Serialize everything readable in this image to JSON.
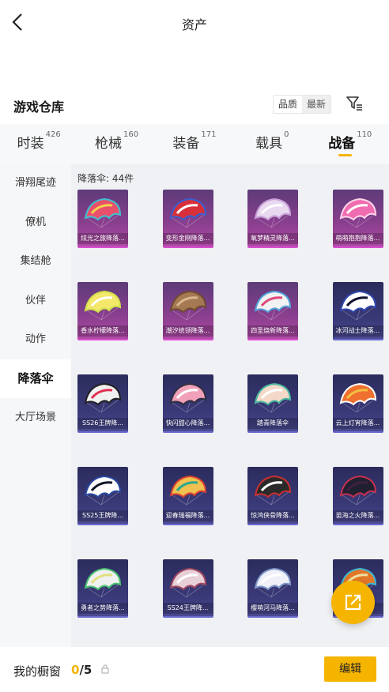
{
  "header": {
    "title": "资产"
  },
  "section": {
    "title": "游戏仓库"
  },
  "sort": {
    "options": [
      "品质",
      "最新"
    ]
  },
  "tabs": [
    {
      "label": "时装",
      "count": "426"
    },
    {
      "label": "枪械",
      "count": "160"
    },
    {
      "label": "装备",
      "count": "171"
    },
    {
      "label": "载具",
      "count": "0"
    },
    {
      "label": "战备",
      "count": "110"
    }
  ],
  "sidebar": {
    "items": [
      "滑翔尾迹",
      "僚机",
      "集结舱",
      "伙伴",
      "动作",
      "降落伞",
      "大厅场景"
    ]
  },
  "grid": {
    "header": "降落伞: 44件",
    "items": [
      {
        "name": "炫光之旅降落...",
        "tone": "pink"
      },
      {
        "name": "变形金刚降落...",
        "tone": "pink"
      },
      {
        "name": "氧梦精灵降落...",
        "tone": "pink"
      },
      {
        "name": "萌萌抱抱降落...",
        "tone": "pink"
      },
      {
        "name": "香水柠檬降落...",
        "tone": "pink"
      },
      {
        "name": "潮汐统领降落...",
        "tone": "pink"
      },
      {
        "name": "四圣烧新降落...",
        "tone": "pink"
      },
      {
        "name": "冰河战士降落...",
        "tone": "blue"
      },
      {
        "name": "SS26王牌降...",
        "tone": "blue"
      },
      {
        "name": "快闪甜心降落...",
        "tone": "blue"
      },
      {
        "name": "踏青降落伞",
        "tone": "blue"
      },
      {
        "name": "云上灯宵降落...",
        "tone": "blue"
      },
      {
        "name": "SS25王牌降...",
        "tone": "blue"
      },
      {
        "name": "迎春瑞福降落...",
        "tone": "blue"
      },
      {
        "name": "惊鸿侠骨降落...",
        "tone": "blue"
      },
      {
        "name": "苗海之火降落...",
        "tone": "blue"
      },
      {
        "name": "勇者之势降落...",
        "tone": "blue"
      },
      {
        "name": "SS24王牌降...",
        "tone": "blue"
      },
      {
        "name": "樱萌河马降落...",
        "tone": "blue"
      },
      {
        "name": "",
        "tone": "blue"
      }
    ]
  },
  "footer": {
    "label": "我的橱窗",
    "current": "0",
    "total": "/5",
    "edit_label": "编辑"
  },
  "colors": {
    "accent": "#f5b400"
  }
}
